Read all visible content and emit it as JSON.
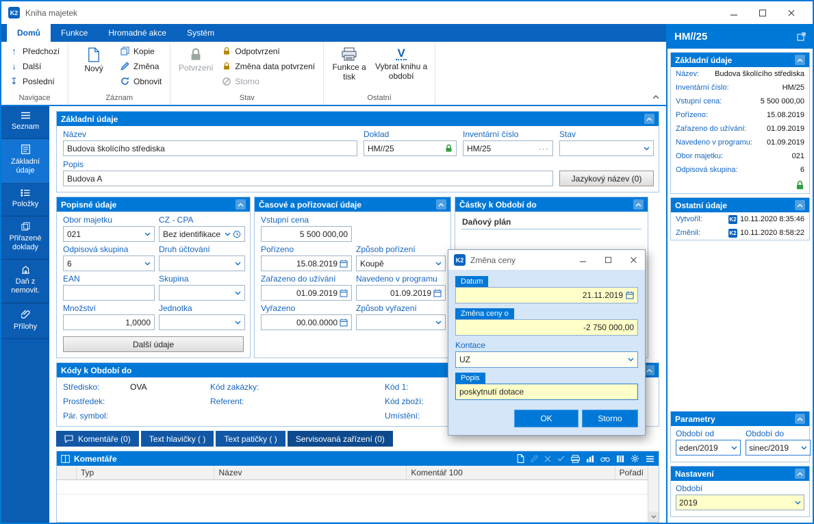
{
  "window": {
    "title": "Kniha majetek",
    "logo": "K2"
  },
  "icons": {
    "arrow_up": "↑",
    "arrow_down": "↓",
    "arrow_down_bar": "↧",
    "ellipsis": "···",
    "v_letter": "V"
  },
  "ribbon": {
    "tabs": [
      "Domů",
      "Funkce",
      "Hromadné akce",
      "Systém"
    ],
    "nav_group": "Navigace",
    "predchozi": "Předchozí",
    "dalsi": "Další",
    "posledni": "Poslední",
    "zaznam_group": "Záznam",
    "novy": "Nový",
    "kopie": "Kopie",
    "zmena": "Změna",
    "obnovit": "Obnovit",
    "stav_group": "Stav",
    "potvrzeni": "Potvrzení",
    "odpotvrzeni": "Odpotvrzení",
    "zmena_data": "Změna data potvrzení",
    "storno": "Storno",
    "ostatni_group": "Ostatní",
    "funkce_tisk": "Funkce a tisk",
    "vybrat_knihu": "Vybrat knihu a období"
  },
  "sidebar": {
    "items": [
      "Seznam",
      "Základní údaje",
      "Položky",
      "Přiřazené doklady",
      "Daň z nemovit.",
      "Přílohy"
    ]
  },
  "zakladni": {
    "title": "Základní údaje",
    "nazev": {
      "label": "Název",
      "value": "Budova školícího střediska"
    },
    "doklad": {
      "label": "Doklad",
      "value": "HM//25"
    },
    "inventarni": {
      "label": "Inventární číslo",
      "value": "HM/25"
    },
    "stav": {
      "label": "Stav",
      "value": ""
    },
    "popis": {
      "label": "Popis",
      "value": "Budova A"
    },
    "jazykovy": "Jazykový název (0)"
  },
  "popisne": {
    "title": "Popisné údaje",
    "obor": {
      "label": "Obor majetku",
      "value": "021"
    },
    "czcpa": {
      "label": "CZ - CPA",
      "value": "Bez identifikace"
    },
    "odpisova": {
      "label": "Odpisová skupina",
      "value": "6"
    },
    "druh": {
      "label": "Druh účtování",
      "value": ""
    },
    "ean": {
      "label": "EAN",
      "value": ""
    },
    "skupina": {
      "label": "Skupina",
      "value": ""
    },
    "mnozstvi": {
      "label": "Množství",
      "value": "1,0000"
    },
    "jednotka": {
      "label": "Jednotka",
      "value": ""
    },
    "dalsi_udaje": "Další údaje"
  },
  "casove": {
    "title": "Časové a pořizovací údaje",
    "vstupni": {
      "label": "Vstupní cena",
      "value": "5 500 000,00"
    },
    "porizeno": {
      "label": "Pořízeno",
      "value": "15.08.2019"
    },
    "zpusob_porizeni": {
      "label": "Způsob pořízení",
      "value": "Koupě"
    },
    "zarazeno": {
      "label": "Zařazeno do užívání",
      "value": "01.09.2019"
    },
    "navedeno": {
      "label": "Navedeno v programu",
      "value": "01.09.2019"
    },
    "vyrazeno": {
      "label": "Vyřazeno",
      "value": "00.00.0000"
    },
    "zpusob_vyrazeni": {
      "label": "Způsob vyřazení",
      "value": ""
    }
  },
  "castky": {
    "title": "Částky k Období do",
    "danovy_plan": "Daňový plán"
  },
  "kody": {
    "title": "Kódy k Období do",
    "rows": [
      [
        {
          "label": "Středisko:",
          "value": "OVA"
        },
        {
          "label": "Kód zakázky:",
          "value": ""
        },
        {
          "label": "Kód 1:",
          "value": ""
        }
      ],
      [
        {
          "label": "Prostředek:",
          "value": ""
        },
        {
          "label": "Referent:",
          "value": ""
        },
        {
          "label": "Kód zboží:",
          "value": ""
        }
      ],
      [
        {
          "label": "Pár. symbol:",
          "value": ""
        },
        {
          "label": "",
          "value": ""
        },
        {
          "label": "Umístění:",
          "value": ""
        }
      ]
    ]
  },
  "doc_tabs": [
    "Komentáře (0)",
    "Text hlavičky ( )",
    "Text patičky ( )",
    "Servisovaná zařízení (0)"
  ],
  "komentare": {
    "title": "Komentáře",
    "columns": [
      "Typ",
      "Název",
      "Komentář 100",
      "Pořadí"
    ]
  },
  "inspector": {
    "title": "HM//25",
    "zakladni_title": "Základní údaje",
    "rows": [
      {
        "label": "Název:",
        "value": "Budova školícího střediska"
      },
      {
        "label": "Inventární číslo:",
        "value": "HM/25"
      },
      {
        "label": "Vstupní cena:",
        "value": "5 500 000,00"
      },
      {
        "label": "Pořízeno:",
        "value": "15.08.2019"
      },
      {
        "label": "Zařazeno do užívání:",
        "value": "01.09.2019"
      },
      {
        "label": "Navedeno v programu:",
        "value": "01.09.2019"
      },
      {
        "label": "Obor majetku:",
        "value": "021"
      },
      {
        "label": "Odpisová skupina:",
        "value": "6"
      }
    ],
    "ostatni_title": "Ostatní údaje",
    "vytvoril": {
      "label": "Vytvořil:",
      "badge": "K2",
      "value": "10.11.2020 8:35:46"
    },
    "zmenil": {
      "label": "Změnil:",
      "badge": "K2",
      "value": "10.11.2020 8:58:22"
    },
    "parametry_title": "Parametry",
    "obdobi_od": {
      "label": "Období od",
      "value": "eden/2019"
    },
    "obdobi_do": {
      "label": "Období do",
      "value": "sinec/2019"
    },
    "nastaveni_title": "Nastavení",
    "obdobi": {
      "label": "Období",
      "value": "2019"
    }
  },
  "modal": {
    "title": "Změna ceny",
    "datum": {
      "label": "Datum",
      "value": "21.11.2019"
    },
    "zmena_ceny": {
      "label": "Změna ceny o",
      "value": "-2 750 000,00"
    },
    "kontace": {
      "label": "Kontace",
      "value": "UZ"
    },
    "popis": {
      "label": "Popis",
      "value": "poskytnutí dotace"
    },
    "ok": "OK",
    "storno": "Storno"
  }
}
